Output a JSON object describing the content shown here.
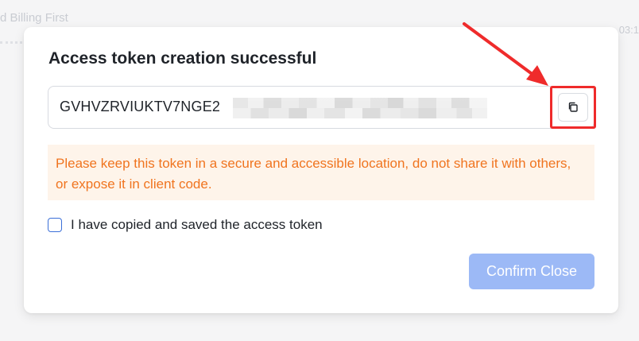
{
  "background": {
    "title_text": "d Billing First",
    "time_text": "03:1"
  },
  "dialog": {
    "title": "Access token creation successful",
    "token_visible": "GVHVZRVIUKTV7NGE2",
    "warning": "Please keep this token in a secure and accessible location, do not share it with others, or expose it in client code.",
    "checkbox_label": "I have copied and saved the access token",
    "checkbox_checked": false,
    "confirm_label": "Confirm Close",
    "copy_icon": "copy-icon"
  },
  "colors": {
    "accent": "#3b6fd8",
    "confirm_disabled": "#9cb9f6",
    "warning_text": "#f0741f",
    "warning_bg": "#fef4ea",
    "annotation": "#ef2b2b"
  }
}
